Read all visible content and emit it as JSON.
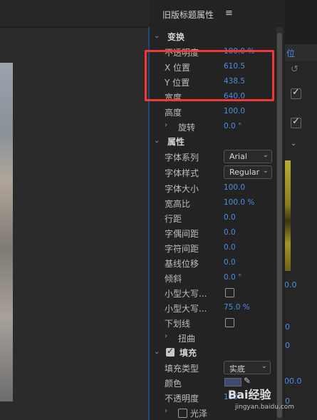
{
  "panel": {
    "title": "旧版标题属性",
    "menu_icon": "≡"
  },
  "transform": {
    "section": "变换",
    "rows": [
      {
        "label": "不透明度",
        "value": "100.0 %"
      },
      {
        "label": "X 位置",
        "value": "610.5"
      },
      {
        "label": "Y 位置",
        "value": "438.5"
      },
      {
        "label": "宽度",
        "value": "640.0"
      },
      {
        "label": "高度",
        "value": "100.0"
      }
    ],
    "rotation": {
      "label": "旋转",
      "value": "0.0 °"
    }
  },
  "properties": {
    "section": "属性",
    "font_family": {
      "label": "字体系列",
      "value": "Arial"
    },
    "font_style": {
      "label": "字体样式",
      "value": "Regular"
    },
    "rows": [
      {
        "label": "字体大小",
        "value": "100.0"
      },
      {
        "label": "宽高比",
        "value": "100.0 %"
      },
      {
        "label": "行距",
        "value": "0.0"
      },
      {
        "label": "字偶间距",
        "value": "0.0"
      },
      {
        "label": "字符间距",
        "value": "0.0"
      },
      {
        "label": "基线位移",
        "value": "0.0"
      },
      {
        "label": "倾斜",
        "value": "0.0 °"
      }
    ],
    "small_caps": {
      "label": "小型大写..."
    },
    "small_caps_size": {
      "label": "小型大写...",
      "value": "75.0 %"
    },
    "underline": {
      "label": "下划线"
    },
    "distort": {
      "label": "扭曲"
    }
  },
  "fill": {
    "section": "填充",
    "fill_type": {
      "label": "填充类型",
      "value": "实底"
    },
    "color": {
      "label": "颜色",
      "swatch": "#3e4a74"
    },
    "opacity": {
      "label": "不透明度",
      "value": "100"
    },
    "sheen": {
      "label": "光泽"
    }
  },
  "right_panel": {
    "tab_label": "位",
    "values": [
      "0.0",
      "00.0",
      "0.0",
      "0",
      "0",
      "00.0",
      "0"
    ]
  },
  "watermark": {
    "text": "Bai经验",
    "url": "jingyan.baidu.com"
  },
  "colors": {
    "accent_value": "#4a8ee0",
    "highlight": "#f03a3a"
  }
}
